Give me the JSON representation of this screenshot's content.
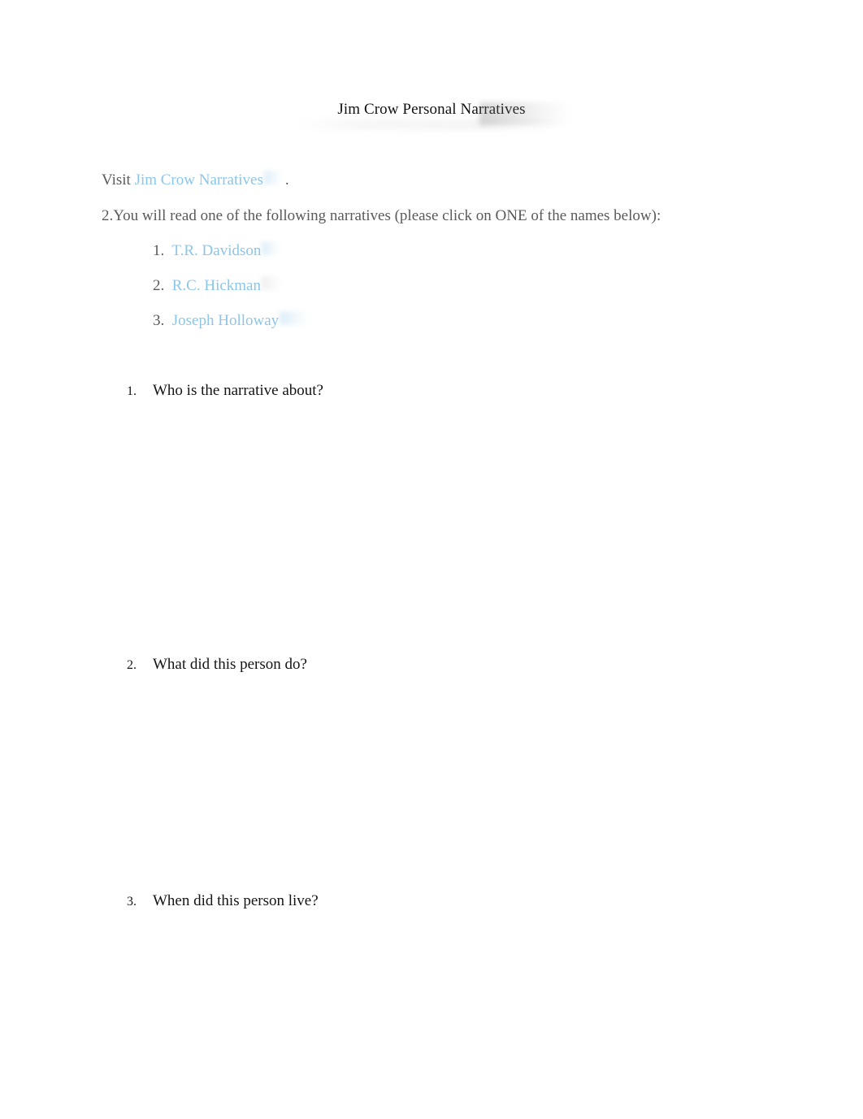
{
  "document": {
    "title": "Jim Crow Personal Narratives"
  },
  "intro": {
    "visit_prefix": "Visit",
    "visit_link_label": "Jim Crow Narratives",
    "visit_suffix": ".",
    "instruction": "2.You will  read  one of the following narratives (please click on ONE of the names below):"
  },
  "narrative_links": [
    {
      "number": "1.",
      "label": "T.R. Davidson"
    },
    {
      "number": "2.",
      "label": "R.C. Hickman"
    },
    {
      "number": "3.",
      "label": "Joseph Holloway"
    }
  ],
  "questions": [
    {
      "number": "1.",
      "text": "Who is the narrative about?",
      "answer": ""
    },
    {
      "number": "2.",
      "text": "What did this person do?",
      "answer": ""
    },
    {
      "number": "3.",
      "text": "When did this person live?",
      "answer": ""
    }
  ],
  "colors": {
    "link": "#8cc6e8",
    "body_text": "#5a5a5a",
    "question_text": "#141414",
    "title_text": "#111111",
    "page_background": "#ffffff"
  }
}
